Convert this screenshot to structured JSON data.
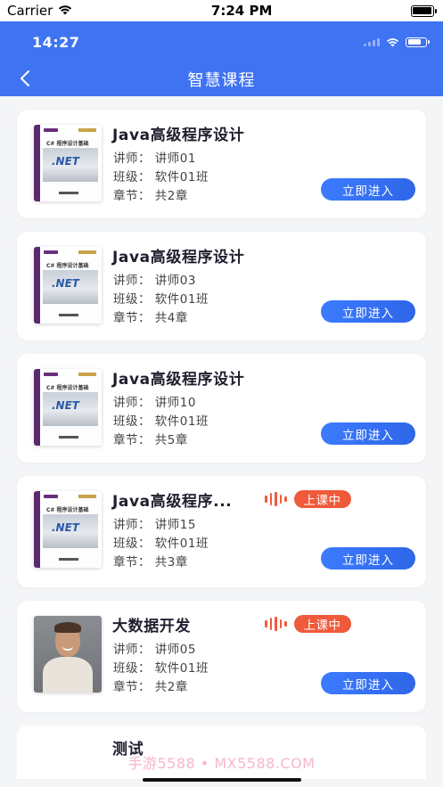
{
  "ios_status": {
    "carrier": "Carrier",
    "time": "7:24 PM"
  },
  "app_status": {
    "time": "14:27"
  },
  "header": {
    "title": "智慧课程"
  },
  "courses": [
    {
      "title": "Java高级程序设计",
      "teacher": "讲师：  讲师01",
      "class": "班级：  软件01班",
      "chapters": "章节：  共2章",
      "button": "立即进入",
      "thumb": "book-cover",
      "live": false
    },
    {
      "title": "Java高级程序设计",
      "teacher": "讲师：  讲师03",
      "class": "班级：  软件01班",
      "chapters": "章节：  共4章",
      "button": "立即进入",
      "thumb": "book-cover",
      "live": false
    },
    {
      "title": "Java高级程序设计",
      "teacher": "讲师：  讲师10",
      "class": "班级：  软件01班",
      "chapters": "章节：  共5章",
      "button": "立即进入",
      "thumb": "book-cover",
      "live": false
    },
    {
      "title": "Java高级程序...",
      "teacher": "讲师：  讲师15",
      "class": "班级：  软件01班",
      "chapters": "章节：  共3章",
      "button": "立即进入",
      "thumb": "book-cover",
      "live": true,
      "live_label": "上课中"
    },
    {
      "title": "大数据开发",
      "teacher": "讲师：  讲师05",
      "class": "班级：  软件01班",
      "chapters": "章节：  共2章",
      "button": "立即进入",
      "thumb": "person-photo",
      "live": true,
      "live_label": "上课中"
    }
  ],
  "partial_course": {
    "title": "测试"
  },
  "cover_text": {
    "title": "C# 程序设计基础",
    "logo": ".NET"
  },
  "watermark": "手游5588 • MX5588.COM",
  "colors": {
    "primary": "#3f73f2",
    "button": "#3c7bff",
    "live": "#ef5a3a",
    "title": "#1e1e2e"
  }
}
